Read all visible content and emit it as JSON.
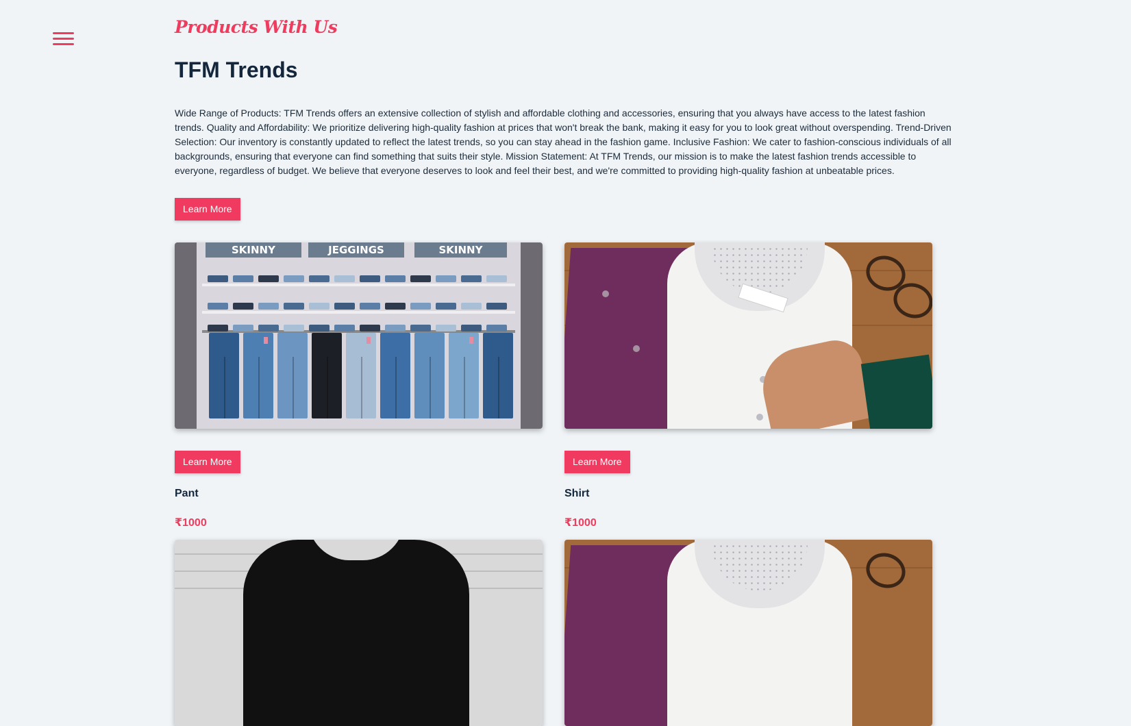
{
  "header": {
    "eyebrow": "Products With Us",
    "title": "TFM Trends",
    "menu_icon": "hamburger-menu-icon"
  },
  "intro": {
    "text": "Wide Range of Products: TFM Trends offers an extensive collection of stylish and affordable clothing and accessories, ensuring that you always have access to the latest fashion trends. Quality and Affordability: We prioritize delivering high-quality fashion at prices that won't break the bank, making it easy for you to look great without overspending. Trend-Driven Selection: Our inventory is constantly updated to reflect the latest trends, so you can stay ahead in the fashion game. Inclusive Fashion: We cater to fashion-conscious individuals of all backgrounds, ensuring that everyone can find something that suits their style. Mission Statement: At TFM Trends, our mission is to make the latest fashion trends accessible to everyone, regardless of budget. We believe that everyone deserves to look and feel their best, and we're committed to providing high-quality fashion at unbeatable prices.",
    "button_label": "Learn More"
  },
  "products": [
    {
      "name": "Pant",
      "price": "₹1000",
      "button_label": "Learn More",
      "image_labels": [
        "SKINNY",
        "JEGGINGS",
        "SKINNY"
      ]
    },
    {
      "name": "Shirt",
      "price": "₹1000",
      "button_label": "Learn More"
    }
  ],
  "colors": {
    "accent": "#ee3c5e",
    "background": "#f0f4f7",
    "heading": "#13263b"
  }
}
